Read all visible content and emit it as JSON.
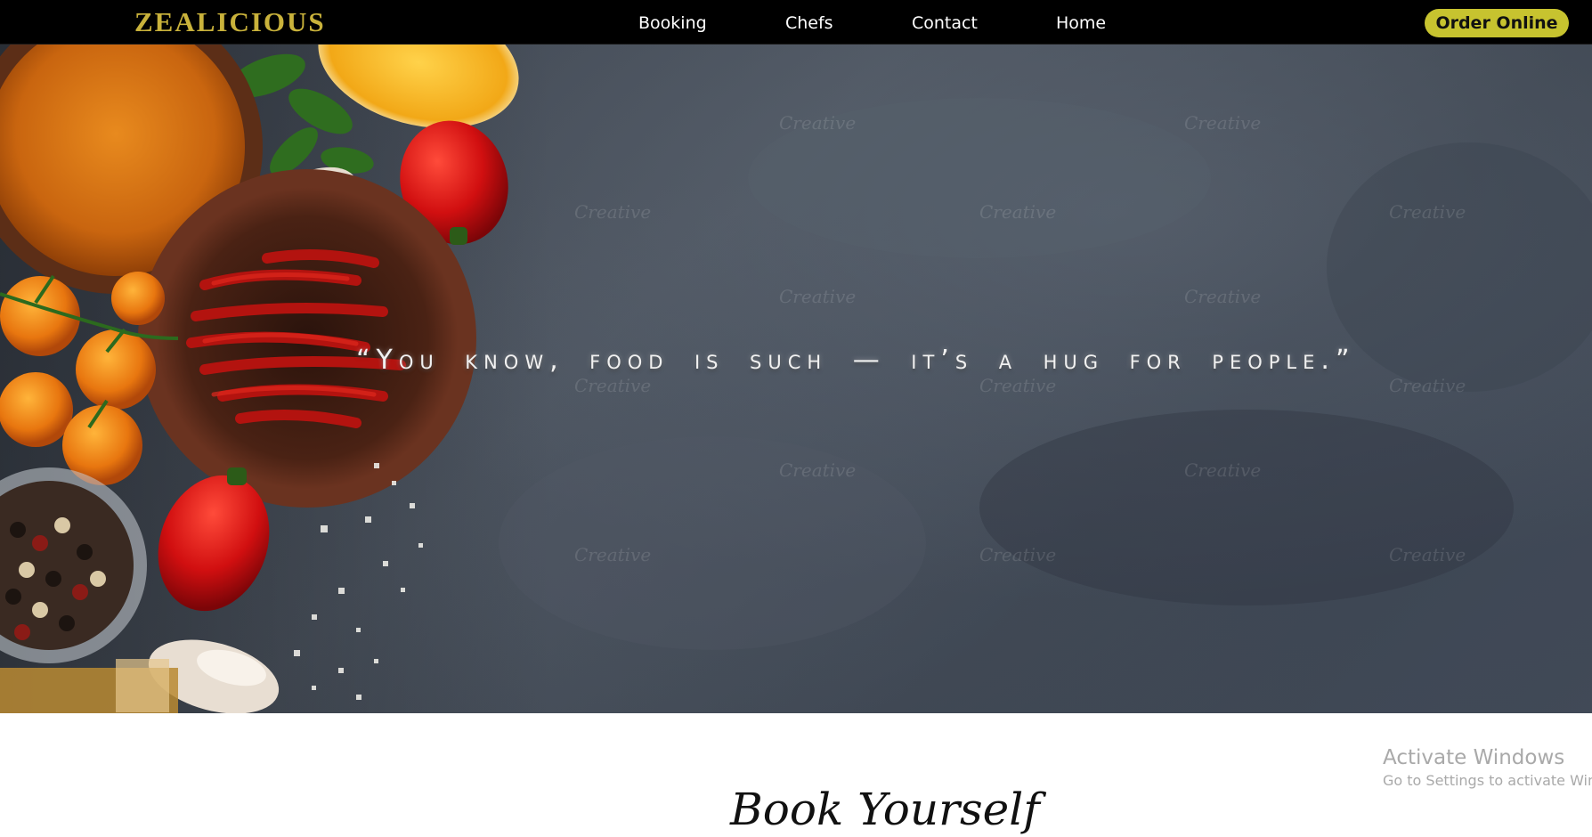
{
  "header": {
    "brand": "ZEALICIOUS",
    "nav": [
      {
        "label": "Booking"
      },
      {
        "label": "Chefs"
      },
      {
        "label": "Contact"
      },
      {
        "label": "Home"
      }
    ],
    "cta_label": "Order Online"
  },
  "hero": {
    "quote": "“You know, food is such — it’s a hug for people.”",
    "watermark": "Creative"
  },
  "booking": {
    "title": "Book Yourself"
  },
  "os_overlay": {
    "title": "Activate Windows",
    "subtitle": "Go to Settings to activate Windows."
  },
  "colors": {
    "navbar_bg": "#000000",
    "brand_gold": "#c9b23b",
    "cta_bg": "#c7c32f",
    "hero_slate": "#434b58"
  }
}
